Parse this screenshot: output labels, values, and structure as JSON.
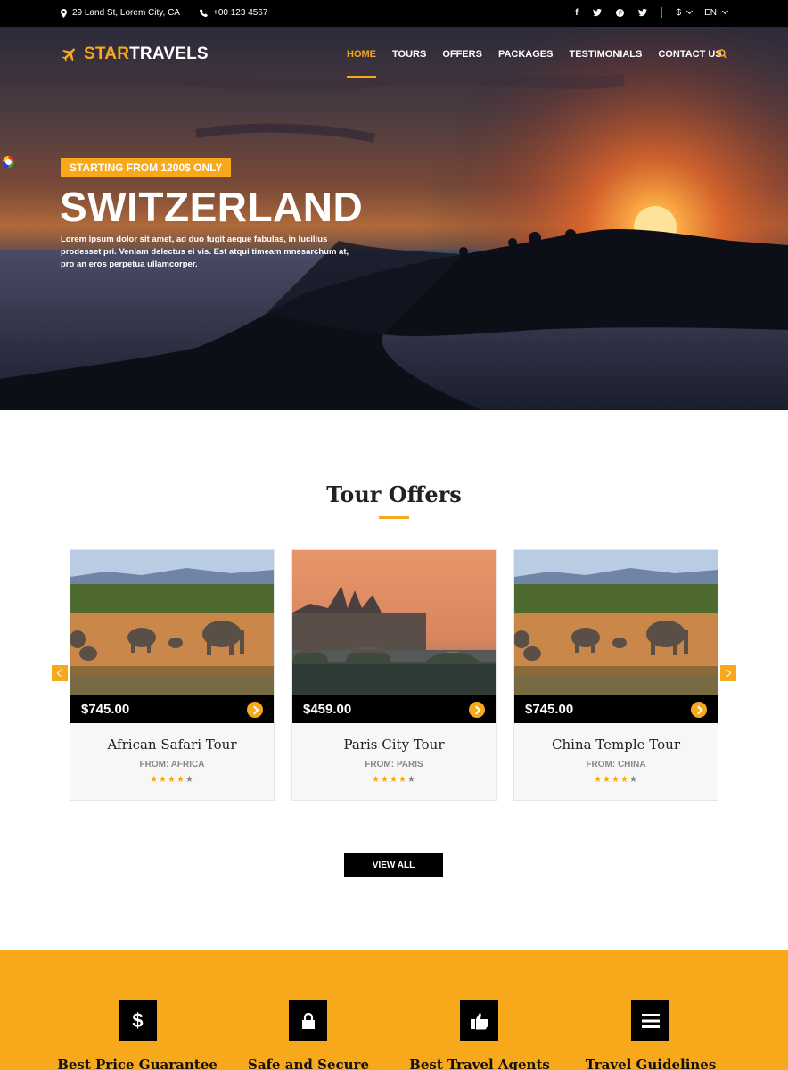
{
  "topbar": {
    "address": "29 Land St, Lorem City, CA",
    "phone": "+00 123 4567",
    "social_icons": [
      "facebook-icon",
      "twitter-icon",
      "pinterest-icon",
      "twitter-icon"
    ],
    "currency": "$",
    "language": "EN"
  },
  "brand": {
    "part1": "STAR",
    "part2": "TRAVELS"
  },
  "nav": {
    "items": [
      "HOME",
      "TOURS",
      "OFFERS",
      "PACKAGES",
      "TESTIMONIALS",
      "CONTACT US"
    ],
    "active": "HOME"
  },
  "hero": {
    "badge": "STARTING FROM 1200$ ONLY",
    "title": "SWITZERLAND",
    "description": "Lorem ipsum dolor sit amet, ad duo fugit aeque fabulas, in lucilius prodesset pri. Veniam delectus ei vis. Est atqui timeam mnesarchum at, pro an eros perpetua ullamcorper."
  },
  "offers": {
    "title": "Tour Offers",
    "cards": [
      {
        "price": "$745.00",
        "name": "African Safari Tour",
        "from": "FROM: AFRICA",
        "rating": 4,
        "max_rating": 5
      },
      {
        "price": "$459.00",
        "name": "Paris City Tour",
        "from": "FROM: PARIS",
        "rating": 4,
        "max_rating": 5
      },
      {
        "price": "$745.00",
        "name": "China Temple Tour",
        "from": "FROM: CHINA",
        "rating": 4,
        "max_rating": 5
      }
    ],
    "view_all": "VIEW ALL"
  },
  "features": [
    {
      "title": "Best Price Guarantee",
      "icon": "dollar-icon"
    },
    {
      "title": "Safe and Secure",
      "icon": "lock-icon"
    },
    {
      "title": "Best Travel Agents",
      "icon": "thumbs-up-icon"
    },
    {
      "title": "Travel Guidelines",
      "icon": "list-icon"
    }
  ],
  "colors": {
    "accent": "#f7a81b",
    "dark": "#000000"
  }
}
